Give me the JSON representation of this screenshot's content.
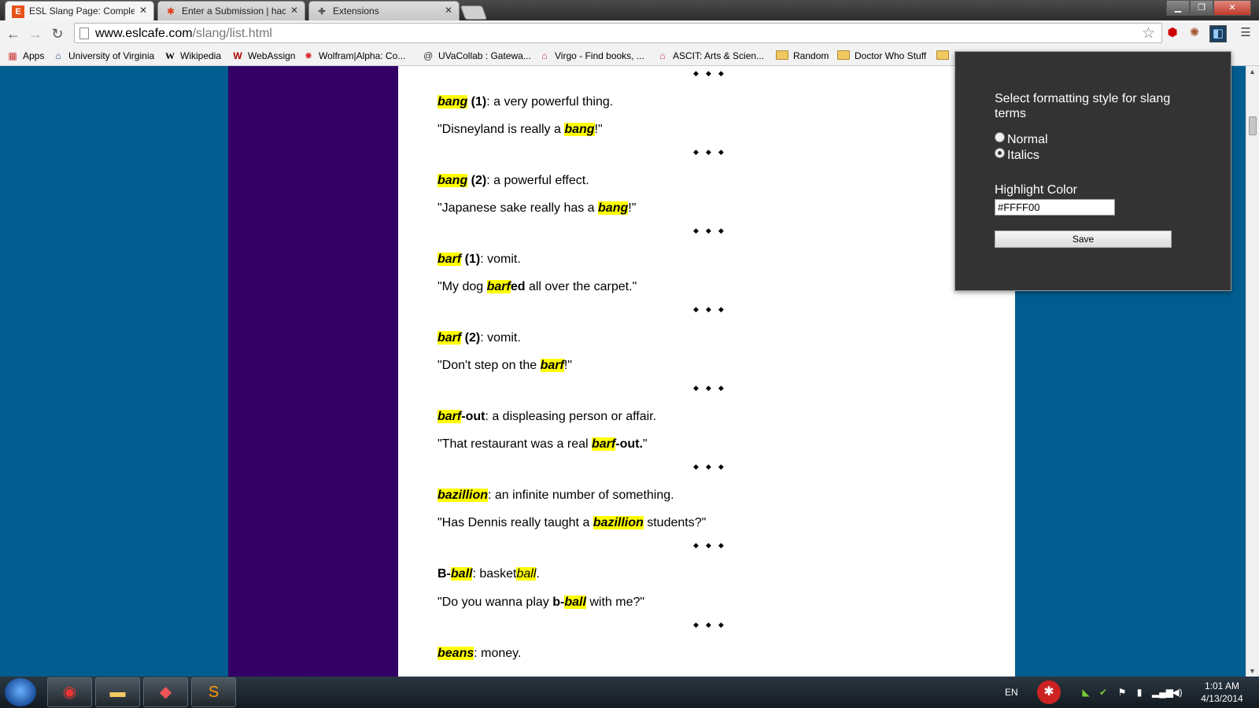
{
  "tabs": [
    {
      "label": "ESL Slang Page: Complete",
      "favicon": "esl-cafe-icon"
    },
    {
      "label": "Enter a Submission | hack",
      "favicon": "pinwheel-icon"
    },
    {
      "label": "Extensions",
      "favicon": "puzzle-icon"
    }
  ],
  "toolbar": {
    "url_host": "www.eslcafe.com",
    "url_path": "/slang/list.html"
  },
  "bookmarks": [
    {
      "label": "Apps",
      "icon": "apps-grid-icon"
    },
    {
      "label": "University of Virginia",
      "icon": "university-icon"
    },
    {
      "label": "Wikipedia",
      "icon": "wikipedia-icon"
    },
    {
      "label": "WebAssign",
      "icon": "webassign-icon"
    },
    {
      "label": "Wolfram|Alpha: Co...",
      "icon": "wolfram-icon"
    },
    {
      "label": "UVaCollab : Gatewa...",
      "icon": "uvacollab-icon"
    },
    {
      "label": "Virgo - Find books, ...",
      "icon": "library-icon"
    },
    {
      "label": "ASCIT: Arts & Scien...",
      "icon": "library-icon"
    },
    {
      "label": "Random",
      "icon": "folder-icon"
    },
    {
      "label": "Doctor Who Stuff",
      "icon": "folder-icon"
    }
  ],
  "content": {
    "entries": [
      {
        "term_hl": "bang",
        "term_rest": " (1)",
        "def": ": a very powerful thing.",
        "ex_pre": "\"Disneyland is really a ",
        "ex_hl": "bang",
        "ex_rest": "",
        "ex_post": "!\""
      },
      {
        "term_hl": "bang",
        "term_rest": " (2)",
        "def": ": a powerful effect.",
        "ex_pre": "\"Japanese sake really has a ",
        "ex_hl": "bang",
        "ex_rest": "",
        "ex_post": "!\""
      },
      {
        "term_hl": "barf",
        "term_rest": " (1)",
        "def": ": vomit.",
        "ex_pre": "\"My dog ",
        "ex_hl": "barf",
        "ex_rest": "ed",
        "ex_post": " all over the carpet.\""
      },
      {
        "term_hl": "barf",
        "term_rest": " (2)",
        "def": ": vomit.",
        "ex_pre": "\"Don't step on the ",
        "ex_hl": "barf",
        "ex_rest": "",
        "ex_post": "!\""
      },
      {
        "term_hl": "barf",
        "term_rest": "-out",
        "def": ": a displeasing person or affair.",
        "ex_pre": "\"That restaurant was a real ",
        "ex_hl": "barf",
        "ex_rest": "-out.",
        "ex_post": "\""
      },
      {
        "term_hl": "bazillion",
        "term_rest": "",
        "def": ": an infinite number of something.",
        "ex_pre": "\"Has Dennis really taught a ",
        "ex_hl": "bazillion",
        "ex_rest": "",
        "ex_post": " students?\""
      },
      {
        "term_pre": "B-",
        "term_hl": "ball",
        "term_rest": "",
        "def": ": basket",
        "def_hl": "ball",
        "def_post": ".",
        "ex_pre": "\"Do you wanna play ",
        "ex_bold_pre": "b-",
        "ex_hl": "ball",
        "ex_rest": "",
        "ex_post": " with me?\""
      },
      {
        "term_hl": "beans",
        "term_rest": "",
        "def": ": money."
      }
    ],
    "separator": "◆◆◆"
  },
  "popup": {
    "title": "Select formatting style for slang terms",
    "options": [
      "Normal",
      "Italics"
    ],
    "selected": "Italics",
    "highlight_label": "Highlight Color",
    "highlight_value": "#FFFF00",
    "save_label": "Save"
  },
  "taskbar": {
    "language": "EN",
    "time": "1:01 AM",
    "date": "4/13/2014"
  },
  "colors": {
    "page_background": "#015d90",
    "side_column": "#330066",
    "highlight": "#FFFF00",
    "popup_background": "#333333"
  }
}
